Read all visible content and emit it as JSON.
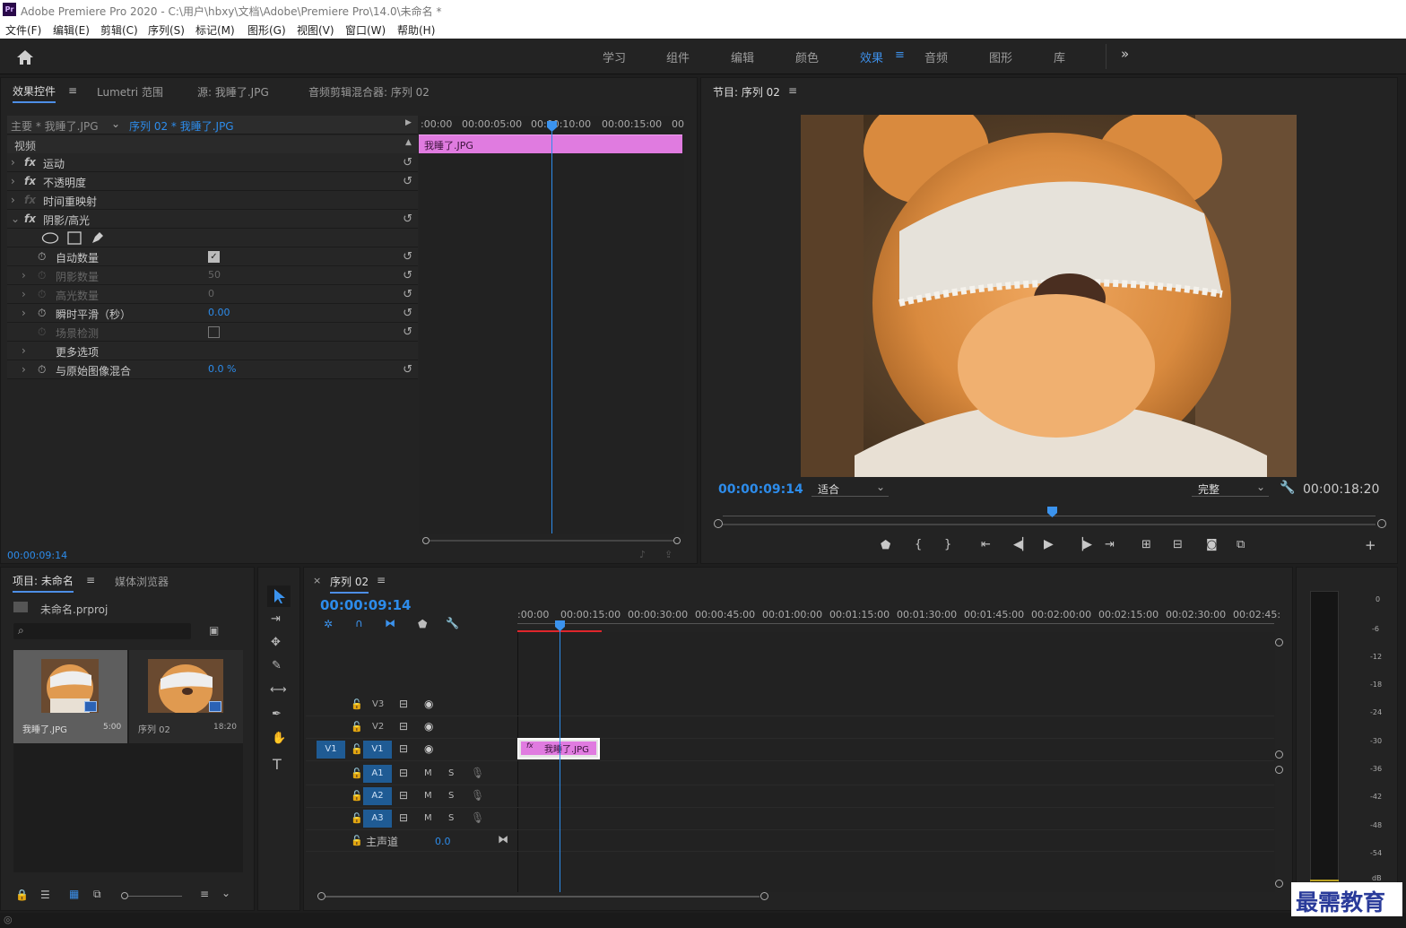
{
  "app": {
    "logo": "Pr",
    "title": "Adobe Premiere Pro 2020 - C:\\用户\\hbxy\\文档\\Adobe\\Premiere Pro\\14.0\\未命名 *"
  },
  "menu": [
    "文件(F)",
    "编辑(E)",
    "剪辑(C)",
    "序列(S)",
    "标记(M)",
    "图形(G)",
    "视图(V)",
    "窗口(W)",
    "帮助(H)"
  ],
  "workspaces": [
    "学习",
    "组件",
    "编辑",
    "颜色",
    "效果",
    "音频",
    "图形",
    "库"
  ],
  "active_workspace": "效果",
  "effect_controls": {
    "tabs": [
      "效果控件",
      "Lumetri 范围",
      "源: 我睡了.JPG",
      "音频剪辑混合器: 序列 02"
    ],
    "master": "主要 * 我睡了.JPG",
    "sequence": "序列 02 * 我睡了.JPG",
    "ruler": [
      ":00:00",
      "00:00:05:00",
      "00:00:10:00",
      "00:00:15:00",
      "00"
    ],
    "clip_label": "我睡了.JPG",
    "section": "视频",
    "effects": [
      "运动",
      "不透明度",
      "时间重映射",
      "阴影/高光"
    ],
    "params": [
      {
        "name": "自动数量",
        "value": ""
      },
      {
        "name": "阴影数量",
        "value": "50"
      },
      {
        "name": "高光数量",
        "value": "0"
      },
      {
        "name": "瞬时平滑（秒）",
        "value": "0.00"
      },
      {
        "name": "场景检测",
        "value": ""
      },
      {
        "name": "更多选项",
        "value": ""
      },
      {
        "name": "与原始图像混合",
        "value": "0.0 %"
      }
    ],
    "timecode": "00:00:09:14"
  },
  "program": {
    "title": "节目: 序列 02",
    "timecode": "00:00:09:14",
    "fit": "适合",
    "quality": "完整",
    "duration": "00:00:18:20"
  },
  "project": {
    "tabs": [
      "项目: 未命名",
      "媒体浏览器"
    ],
    "file": "未命名.prproj",
    "items": [
      {
        "name": "我睡了.JPG",
        "duration": "5:00"
      },
      {
        "name": "序列 02",
        "duration": "18:20"
      }
    ]
  },
  "timeline": {
    "title": "序列 02",
    "timecode": "00:00:09:14",
    "ruler": [
      ":00:00",
      "00:00:15:00",
      "00:00:30:00",
      "00:00:45:00",
      "00:01:00:00",
      "00:01:15:00",
      "00:01:30:00",
      "00:01:45:00",
      "00:02:00:00",
      "00:02:15:00",
      "00:02:30:00",
      "00:02:45:"
    ],
    "video_tracks": [
      "V3",
      "V2",
      "V1"
    ],
    "audio_tracks": [
      "A1",
      "A2",
      "A3"
    ],
    "src_track": "V1",
    "mute": "M",
    "solo": "S",
    "master": "主声道",
    "master_value": "0.0",
    "clip_label": "我睡了.JPG",
    "fx": "fx"
  },
  "meter": {
    "scale": [
      "0",
      "-6",
      "-12",
      "-18",
      "-24",
      "-30",
      "-36",
      "-42",
      "-48",
      "-54",
      "dB"
    ]
  },
  "watermark": "最需教育",
  "colors": {
    "accent": "#2d8ceb",
    "clip": "#e07be0",
    "track_target": "#1f5b94"
  }
}
